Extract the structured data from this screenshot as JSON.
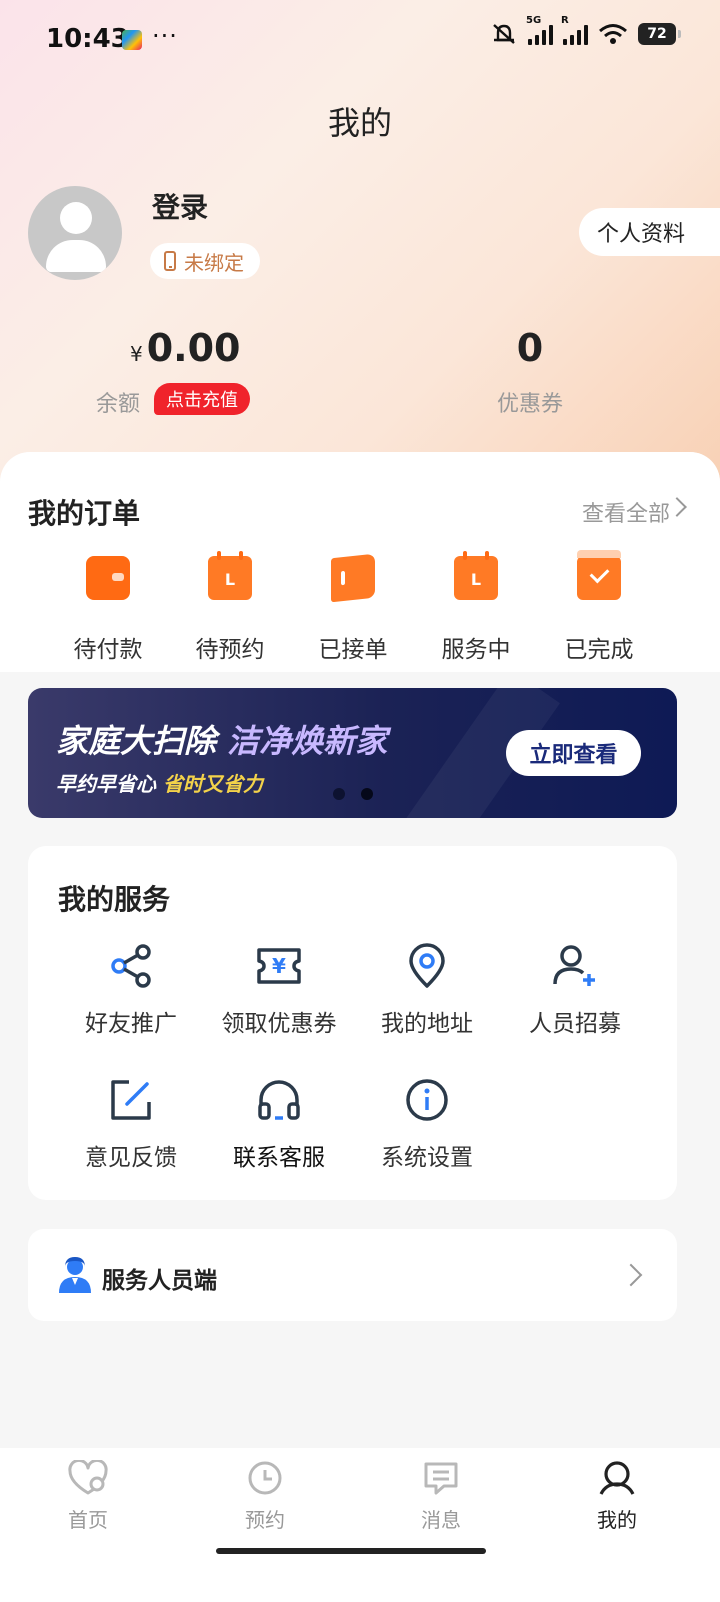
{
  "status": {
    "time": "10:43",
    "more": "···",
    "net1": "5G",
    "net2": "R",
    "battery": "72"
  },
  "header": {
    "title": "我的"
  },
  "profile": {
    "login": "登录",
    "bind_status": "未绑定",
    "profile_button": "个人资料"
  },
  "wallet": {
    "currency": "¥",
    "balance": "0.00",
    "balance_label": "余额",
    "recharge_button": "点击充值",
    "coupons": "0",
    "coupons_label": "优惠券"
  },
  "orders": {
    "title": "我的订单",
    "view_all": "查看全部",
    "items": [
      {
        "label": "待付款",
        "icon": "wallet-icon"
      },
      {
        "label": "待预约",
        "icon": "calendar-icon"
      },
      {
        "label": "已接单",
        "icon": "door-icon"
      },
      {
        "label": "服务中",
        "icon": "calendar-icon"
      },
      {
        "label": "已完成",
        "icon": "calendar-check-icon"
      }
    ]
  },
  "banner": {
    "title_main": "家庭大扫除",
    "title_highlight": "洁净焕新家",
    "sub_main": "早约早省心",
    "sub_highlight": "省时又省力",
    "button": "立即查看",
    "active_slide": 2,
    "slides": 2
  },
  "services": {
    "title": "我的服务",
    "items": [
      {
        "label": "好友推广",
        "icon": "share-icon"
      },
      {
        "label": "领取优惠券",
        "icon": "coupon-icon"
      },
      {
        "label": "我的地址",
        "icon": "location-icon"
      },
      {
        "label": "人员招募",
        "icon": "add-user-icon"
      },
      {
        "label": "意见反馈",
        "icon": "edit-icon"
      },
      {
        "label": "联系客服",
        "icon": "headset-icon"
      },
      {
        "label": "系统设置",
        "icon": "info-icon"
      }
    ]
  },
  "staff": {
    "label": "服务人员端",
    "icon": "staff-icon"
  },
  "tabs": [
    {
      "label": "首页",
      "icon": "heart-icon",
      "active": false
    },
    {
      "label": "预约",
      "icon": "clock-icon",
      "active": false
    },
    {
      "label": "消息",
      "icon": "message-icon",
      "active": false
    },
    {
      "label": "我的",
      "icon": "user-icon",
      "active": true
    }
  ],
  "colors": {
    "accent_orange": "#ff6a13",
    "service_blue": "#2f7cf6",
    "icon_dark": "#2b3a4a",
    "recharge_red": "#f0232b"
  }
}
